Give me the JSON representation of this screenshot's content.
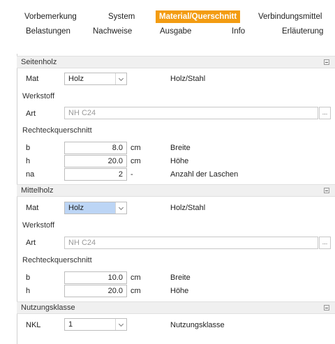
{
  "tabs": {
    "row1": [
      "Vorbemerkung",
      "System",
      "Material/Querschnitt",
      "Verbindungsmittel"
    ],
    "row2": [
      "Belastungen",
      "Nachweise",
      "Ausgabe",
      "Info",
      "Erläuterung"
    ]
  },
  "colors": {
    "active_tab": "#f39c12",
    "section_bg": "#f0f0f0",
    "highlight": "#bcd5f5"
  },
  "seitenholz": {
    "title": "Seitenholz",
    "mat_label": "Mat",
    "mat_value": "Holz",
    "mat_desc": "Holz/Stahl",
    "werkstoff": "Werkstoff",
    "art_label": "Art",
    "art_value": "NH C24",
    "dots": "...",
    "querschnitt": "Rechteckquerschnitt",
    "rows": [
      {
        "label": "b",
        "value": "8.0",
        "unit": "cm",
        "desc": "Breite"
      },
      {
        "label": "h",
        "value": "20.0",
        "unit": "cm",
        "desc": "Höhe"
      },
      {
        "label": "na",
        "value": "2",
        "unit": "-",
        "desc": "Anzahl der Laschen"
      }
    ]
  },
  "mittelholz": {
    "title": "Mittelholz",
    "mat_label": "Mat",
    "mat_value": "Holz",
    "mat_desc": "Holz/Stahl",
    "werkstoff": "Werkstoff",
    "art_label": "Art",
    "art_value": "NH C24",
    "dots": "...",
    "querschnitt": "Rechteckquerschnitt",
    "rows": [
      {
        "label": "b",
        "value": "10.0",
        "unit": "cm",
        "desc": "Breite"
      },
      {
        "label": "h",
        "value": "20.0",
        "unit": "cm",
        "desc": "Höhe"
      }
    ]
  },
  "nutzungsklasse": {
    "title": "Nutzungsklasse",
    "nkl_label": "NKL",
    "nkl_value": "1",
    "nkl_desc": "Nutzungsklasse"
  }
}
